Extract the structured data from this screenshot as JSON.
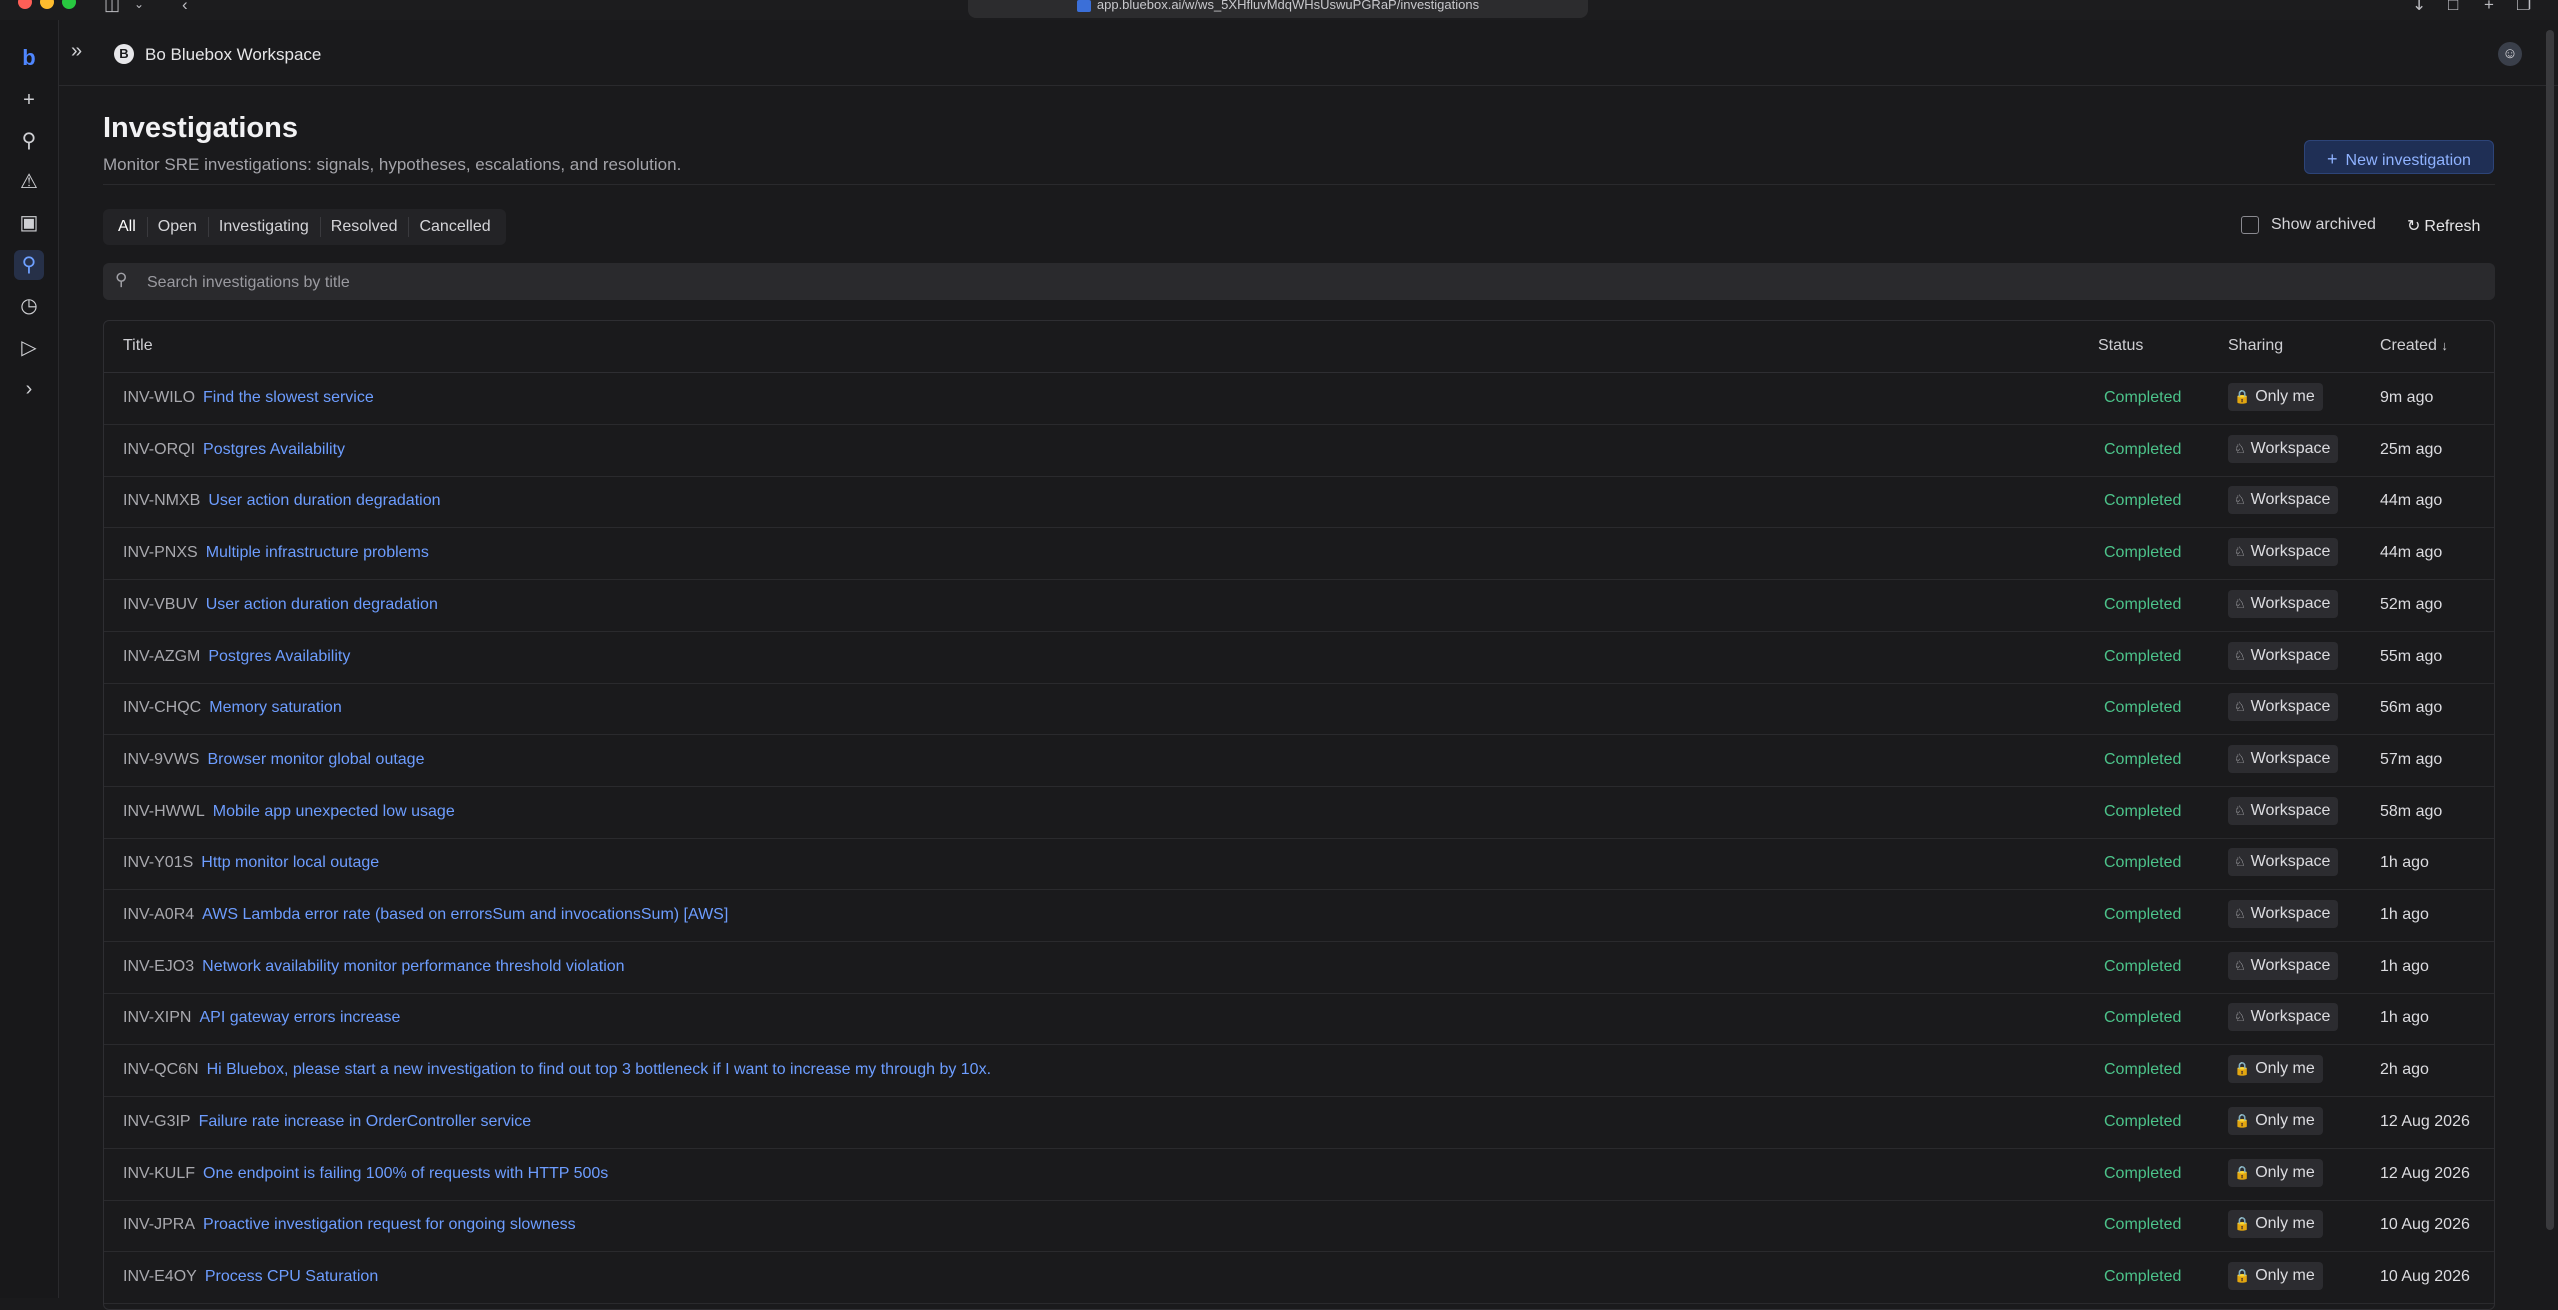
{
  "browser": {
    "url": "app.bluebox.ai/w/ws_5XHfluvMdqWHsUswuPGRaP/investigations"
  },
  "workspace": {
    "badge": "B",
    "name": "Bo Bluebox Workspace"
  },
  "page": {
    "title": "Investigations",
    "subtitle": "Monitor SRE investigations: signals, hypotheses, escalations, and resolution.",
    "new_button_label": "New investigation"
  },
  "filters": {
    "tabs": [
      "All",
      "Open",
      "Investigating",
      "Resolved",
      "Cancelled"
    ],
    "active": "All",
    "show_archived_label": "Show archived",
    "show_archived_checked": false,
    "refresh_label": "Refresh"
  },
  "search": {
    "placeholder": "Search investigations by title",
    "value": ""
  },
  "table": {
    "columns": {
      "title": "Title",
      "status": "Status",
      "sharing": "Sharing",
      "created": "Created",
      "sort": "desc"
    },
    "rows": [
      {
        "id": "INV-WILO",
        "title": "Find the slowest service",
        "status": "Completed",
        "sharing": "Only me",
        "created": "9m ago"
      },
      {
        "id": "INV-ORQI",
        "title": "Postgres Availability",
        "status": "Completed",
        "sharing": "Workspace",
        "created": "25m ago"
      },
      {
        "id": "INV-NMXB",
        "title": "User action duration degradation",
        "status": "Completed",
        "sharing": "Workspace",
        "created": "44m ago"
      },
      {
        "id": "INV-PNXS",
        "title": "Multiple infrastructure problems",
        "status": "Completed",
        "sharing": "Workspace",
        "created": "44m ago"
      },
      {
        "id": "INV-VBUV",
        "title": "User action duration degradation",
        "status": "Completed",
        "sharing": "Workspace",
        "created": "52m ago"
      },
      {
        "id": "INV-AZGM",
        "title": "Postgres Availability",
        "status": "Completed",
        "sharing": "Workspace",
        "created": "55m ago"
      },
      {
        "id": "INV-CHQC",
        "title": "Memory saturation",
        "status": "Completed",
        "sharing": "Workspace",
        "created": "56m ago"
      },
      {
        "id": "INV-9VWS",
        "title": "Browser monitor global outage",
        "status": "Completed",
        "sharing": "Workspace",
        "created": "57m ago"
      },
      {
        "id": "INV-HWWL",
        "title": "Mobile app unexpected low usage",
        "status": "Completed",
        "sharing": "Workspace",
        "created": "58m ago"
      },
      {
        "id": "INV-Y01S",
        "title": "Http monitor local outage",
        "status": "Completed",
        "sharing": "Workspace",
        "created": "1h ago"
      },
      {
        "id": "INV-A0R4",
        "title": "AWS Lambda error rate (based on errorsSum and invocationsSum) [AWS]",
        "status": "Completed",
        "sharing": "Workspace",
        "created": "1h ago"
      },
      {
        "id": "INV-EJO3",
        "title": "Network availability monitor performance threshold violation",
        "status": "Completed",
        "sharing": "Workspace",
        "created": "1h ago"
      },
      {
        "id": "INV-XIPN",
        "title": "API gateway errors increase",
        "status": "Completed",
        "sharing": "Workspace",
        "created": "1h ago"
      },
      {
        "id": "INV-QC6N",
        "title": "Hi Bluebox, please start a new investigation to find out top 3 bottleneck if I want to increase my through by 10x.",
        "status": "Completed",
        "sharing": "Only me",
        "created": "2h ago"
      },
      {
        "id": "INV-G3IP",
        "title": "Failure rate increase in OrderController service",
        "status": "Completed",
        "sharing": "Only me",
        "created": "12 Aug 2026"
      },
      {
        "id": "INV-KULF",
        "title": "One endpoint is failing 100% of requests with HTTP 500s",
        "status": "Completed",
        "sharing": "Only me",
        "created": "12 Aug 2026"
      },
      {
        "id": "INV-JPRA",
        "title": "Proactive investigation request for ongoing slowness",
        "status": "Completed",
        "sharing": "Only me",
        "created": "10 Aug 2026"
      },
      {
        "id": "INV-E4OY",
        "title": "Process CPU Saturation",
        "status": "Completed",
        "sharing": "Only me",
        "created": "10 Aug 2026"
      }
    ]
  },
  "icons": {
    "only_me": "lock-icon",
    "workspace": "users-icon",
    "sort": "arrow-down-icon"
  },
  "colors": {
    "accent": "#6d9dff",
    "status_completed": "#4cc38a",
    "background": "#1a1a1c"
  }
}
